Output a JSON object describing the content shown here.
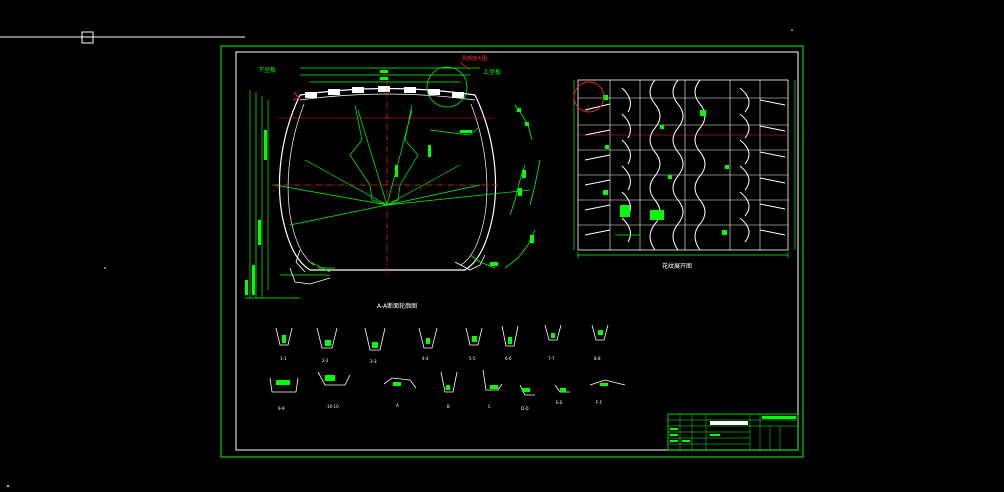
{
  "drawing": {
    "section_title": "A-A断面轮廓图",
    "tread_title": "花纹展开图",
    "left_corner_label": "下坐板",
    "right_corner_label": "上坐板",
    "circle_note": "局部放大图",
    "section_ids_row1": [
      "1-1",
      "2-2",
      "3-3",
      "4-4",
      "5-5",
      "6-6",
      "7-7",
      "8-8"
    ],
    "section_ids_row2": [
      "9-9",
      "10-10",
      "A",
      "B",
      "C",
      "D-D",
      "E-E",
      "F-F"
    ]
  },
  "colors": {
    "background": "#000000",
    "frame": "#00ff00",
    "lines": "#ffffff",
    "dimension": "#00ff00",
    "center": "#ff2020"
  }
}
